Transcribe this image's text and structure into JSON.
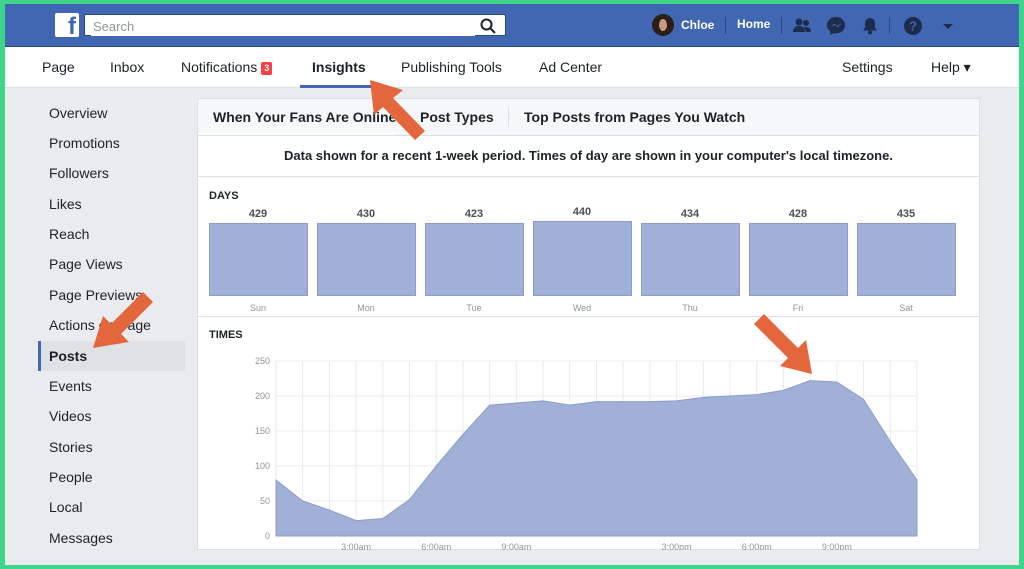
{
  "topbar": {
    "logo_letter": "f",
    "search_placeholder": "Search",
    "user_name": "Chloe",
    "home_label": "Home"
  },
  "nav": {
    "items": [
      {
        "label": "Page"
      },
      {
        "label": "Inbox"
      },
      {
        "label": "Notifications",
        "badge": "3"
      },
      {
        "label": "Insights",
        "active": true
      },
      {
        "label": "Publishing Tools"
      },
      {
        "label": "Ad Center"
      },
      {
        "label": "Settings"
      },
      {
        "label": "Help ▾"
      }
    ]
  },
  "sidebar": {
    "items": [
      {
        "label": "Overview"
      },
      {
        "label": "Promotions"
      },
      {
        "label": "Followers"
      },
      {
        "label": "Likes"
      },
      {
        "label": "Reach"
      },
      {
        "label": "Page Views"
      },
      {
        "label": "Page Previews"
      },
      {
        "label": "Actions on Page"
      },
      {
        "label": "Posts",
        "active": true
      },
      {
        "label": "Events"
      },
      {
        "label": "Videos"
      },
      {
        "label": "Stories"
      },
      {
        "label": "People"
      },
      {
        "label": "Local"
      },
      {
        "label": "Messages"
      }
    ]
  },
  "tabs": [
    {
      "label": "When Your Fans Are Online",
      "active": true
    },
    {
      "label": "Post Types"
    },
    {
      "label": "Top Posts from Pages You Watch"
    }
  ],
  "notice": "Data shown for a recent 1-week period. Times of day are shown in your computer's local timezone.",
  "days_section": {
    "label": "DAYS",
    "days": [
      {
        "name": "Sun",
        "value": "429"
      },
      {
        "name": "Mon",
        "value": "430"
      },
      {
        "name": "Tue",
        "value": "423"
      },
      {
        "name": "Wed",
        "value": "440"
      },
      {
        "name": "Thu",
        "value": "434"
      },
      {
        "name": "Fri",
        "value": "428"
      },
      {
        "name": "Sat",
        "value": "435"
      }
    ]
  },
  "times_section": {
    "label": "TIMES"
  },
  "colors": {
    "brand": "#4267b2",
    "chart_fill": "#a1b0d6",
    "chart_stroke": "#8a9cc9",
    "annotation_arrow": "#e4663d",
    "frame_border": "#3ed58a"
  },
  "chart_data": {
    "type": "area",
    "title": "",
    "xlabel": "",
    "ylabel": "",
    "ylim": [
      0,
      250
    ],
    "yticks": [
      "0",
      "50",
      "100",
      "150",
      "200",
      "250"
    ],
    "xticks": [
      {
        "hour": 3,
        "label": "3:00am"
      },
      {
        "hour": 6,
        "label": "6:00am"
      },
      {
        "hour": 9,
        "label": "9:00am"
      },
      {
        "hour": 15,
        "label": "3:00pm"
      },
      {
        "hour": 18,
        "label": "6:00pm"
      },
      {
        "hour": 21,
        "label": "9:00pm"
      }
    ],
    "grid": true,
    "x": [
      0,
      1,
      2,
      3,
      4,
      5,
      6,
      7,
      8,
      9,
      10,
      11,
      12,
      13,
      14,
      15,
      16,
      17,
      18,
      19,
      20,
      21,
      22,
      23,
      24
    ],
    "y": [
      80,
      50,
      37,
      22,
      25,
      52,
      100,
      145,
      187,
      190,
      193,
      187,
      192,
      192,
      192,
      193,
      198,
      200,
      202,
      208,
      222,
      220,
      195,
      135,
      80
    ]
  }
}
